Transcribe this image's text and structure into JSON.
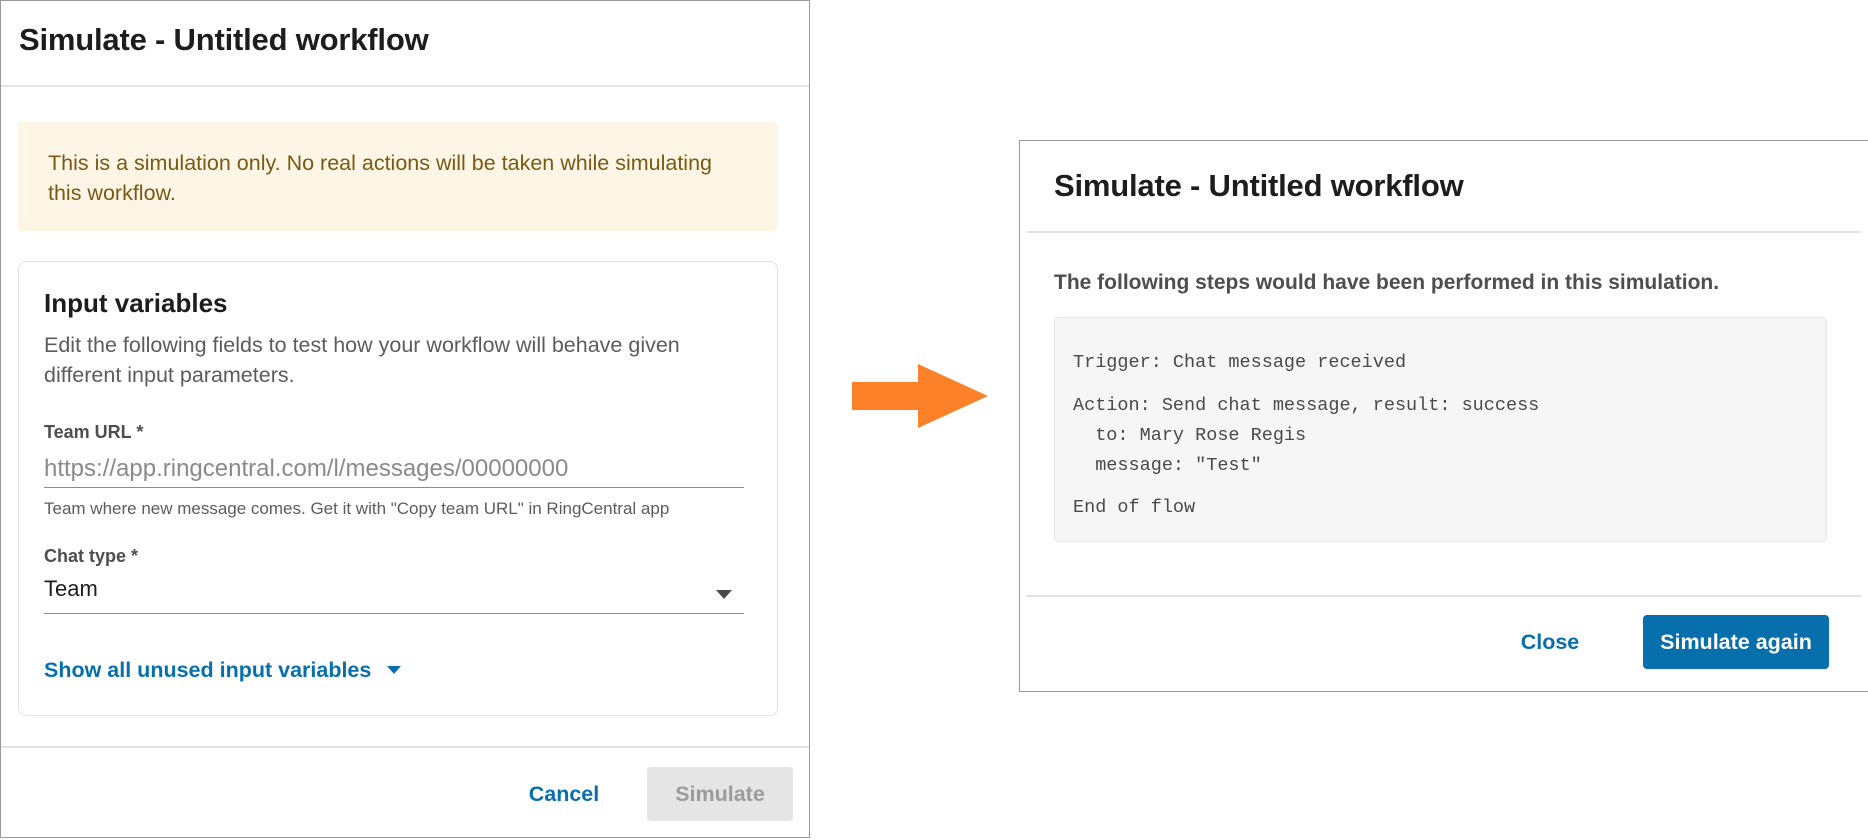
{
  "left_dialog": {
    "title": "Simulate - Untitled workflow",
    "banner": "This is a simulation only. No real actions will be taken while simulating this workflow.",
    "input_card": {
      "title": "Input variables",
      "description": "Edit the following fields to test how your workflow will behave given different input parameters.",
      "team_url": {
        "label": "Team URL *",
        "placeholder": "https://app.ringcentral.com/l/messages/00000000",
        "value": "",
        "help": "Team where new message comes. Get it with \"Copy team URL\" in RingCentral app"
      },
      "chat_type": {
        "label": "Chat type *",
        "value": "Team"
      },
      "show_all_link": "Show all unused input variables"
    },
    "footer": {
      "cancel": "Cancel",
      "simulate": "Simulate"
    }
  },
  "arrow": {
    "color": "#fd8128",
    "icon": "arrow-right-icon"
  },
  "right_dialog": {
    "title": "Simulate - Untitled workflow",
    "heading": "The following steps would have been performed in this simulation.",
    "steps": {
      "trigger": "Trigger: Chat message received",
      "action": "Action: Send chat message, result: success",
      "to": "  to: Mary Rose Regis",
      "message": "  message: \"Test\"",
      "end": "End of flow"
    },
    "footer": {
      "close": "Close",
      "simulate_again": "Simulate again"
    }
  },
  "colors": {
    "accent": "#066fac",
    "banner_bg": "#fdf5e5",
    "banner_text": "#7a5a12",
    "disabled_bg": "#e5e5e5",
    "arrow": "#fd8128"
  }
}
